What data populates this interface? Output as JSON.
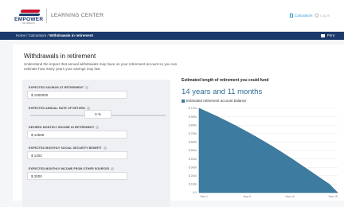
{
  "header": {
    "brand_word": "EMPOWER",
    "brand_sub": "RETIREMENT",
    "section": "LEARNING CENTER",
    "calculators_link": "Calculators",
    "login_link": "Log in"
  },
  "nav": {
    "crumb_prefix": "Home / Calculators / ",
    "crumb_current": "Withdrawals in retirement",
    "print": "Print"
  },
  "page": {
    "title": "Withdrawals in retirement",
    "description": "Understand the impact that annual withdrawals may have on your retirement account so you can estimate how many years your savings may last."
  },
  "form": {
    "savings_label": "EXPECTED SAVINGS AT RETIREMENT",
    "savings_value": "$ 1000000",
    "return_label": "EXPECTED ANNUAL RATE OF RETURN",
    "return_value": "0 %",
    "income_label": "DESIRED MONTHLY INCOME IN RETIREMENT",
    "income_value": "$ 12569",
    "ss_label": "EXPECTED MONTHLY SOCIAL SECURITY BENEFIT",
    "ss_value": "$ 1402",
    "other_label": "EXPECTED MONTHLY INCOME FROM OTHER SOURCES",
    "other_value": "$ 2000"
  },
  "result": {
    "heading": "Estimated length of retirement you could fund",
    "value": "14 years and 11 months",
    "legend": "Estimated retirement account balance"
  },
  "chart_data": {
    "type": "area",
    "series": [
      {
        "name": "Estimated retirement account balance",
        "values": [
          1000000,
          900000,
          790000,
          670000,
          540000,
          400000,
          250000,
          100000,
          0
        ]
      }
    ],
    "x": [
      0,
      2,
      4,
      6,
      8,
      10,
      12,
      14,
      14.9
    ],
    "ylim": [
      0,
      1000000
    ],
    "ytick_labels": [
      "$ 1.0m",
      "$ 900k",
      "$ 800k",
      "$ 700k",
      "$ 600k",
      "$ 500k",
      "$ 400k",
      "$ 300k",
      "$ 200k",
      "$ 100k",
      "$ 0"
    ],
    "xtick_labels": [
      "Year 1",
      "Year 5",
      "Year 10",
      "Year 15"
    ],
    "color": "#3e7ba0"
  }
}
